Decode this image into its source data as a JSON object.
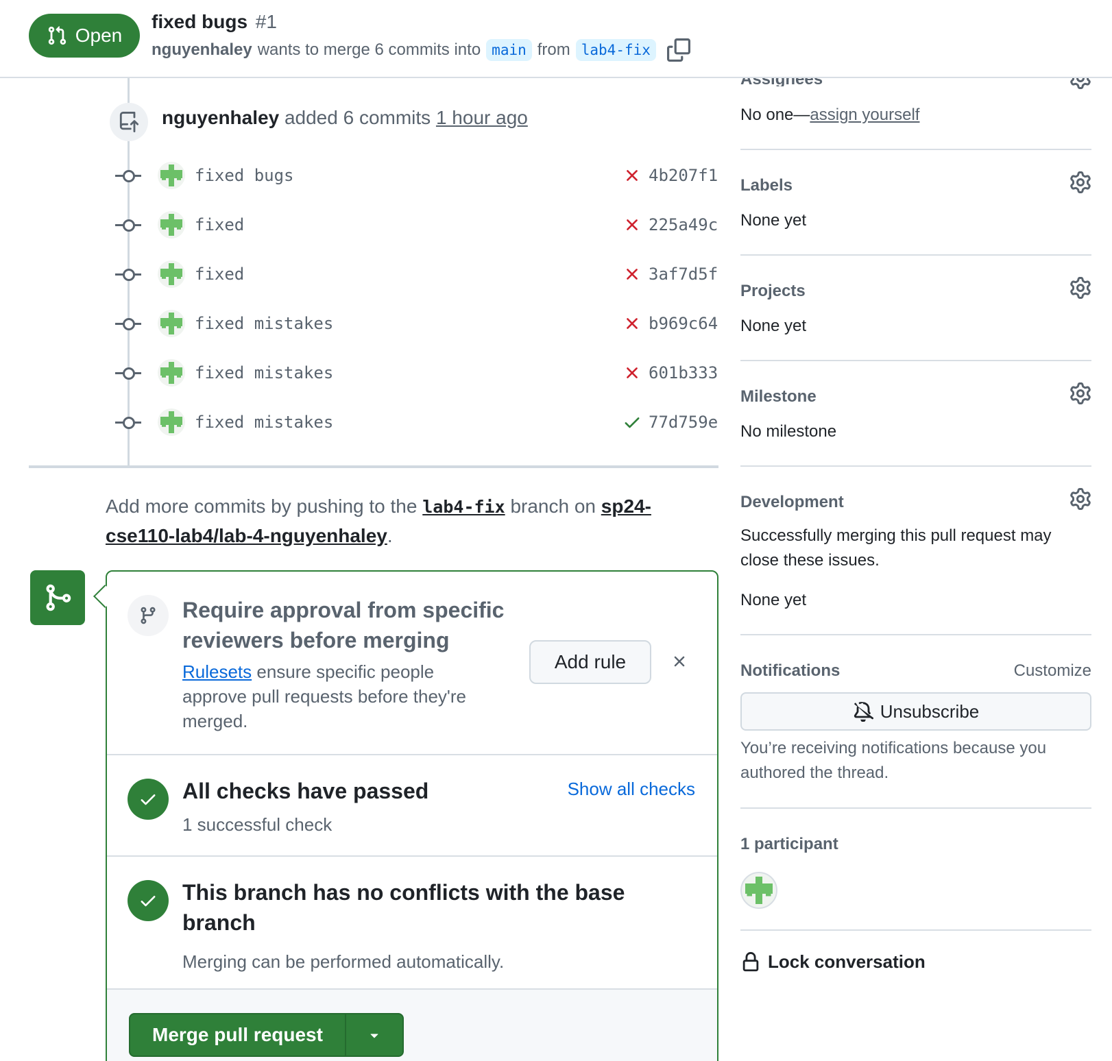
{
  "header": {
    "state": "Open",
    "title": "fixed bugs",
    "number": "#1",
    "author": "nguyenhaley",
    "merge_text": "wants to merge 6 commits into",
    "base_branch": "main",
    "from_text": "from",
    "head_branch": "lab4-fix"
  },
  "timeline": {
    "push_author": "nguyenhaley",
    "push_action": "added 6 commits",
    "push_time": "1 hour ago",
    "commits": [
      {
        "message": "fixed bugs",
        "sha": "4b207f1",
        "status": "failed"
      },
      {
        "message": "fixed",
        "sha": "225a49c",
        "status": "failed"
      },
      {
        "message": "fixed",
        "sha": "3af7d5f",
        "status": "failed"
      },
      {
        "message": "fixed mistakes",
        "sha": "b969c64",
        "status": "failed"
      },
      {
        "message": "fixed mistakes",
        "sha": "601b333",
        "status": "failed"
      },
      {
        "message": "fixed mistakes",
        "sha": "77d759e",
        "status": "success"
      }
    ]
  },
  "add_more": {
    "prefix": "Add more commits by pushing to the",
    "branch": "lab4-fix",
    "middle": "branch on",
    "repo": "sp24-cse110-lab4/lab-4-nguyenhaley",
    "suffix": "."
  },
  "merge_box": {
    "rule_title": "Require approval from specific reviewers before merging",
    "rule_link": "Rulesets",
    "rule_desc": "ensure specific people approve pull requests before they're merged.",
    "add_rule": "Add rule",
    "checks_title": "All checks have passed",
    "checks_sub": "1 successful check",
    "show_checks": "Show all checks",
    "conflicts_title": "This branch has no conflicts with the base branch",
    "conflicts_sub": "Merging can be performed automatically.",
    "merge_button": "Merge pull request"
  },
  "sidebar": {
    "assignees_head": "Assignees",
    "assignees_none": "No one—",
    "assign_yourself": "assign yourself",
    "labels_head": "Labels",
    "labels_value": "None yet",
    "projects_head": "Projects",
    "projects_value": "None yet",
    "milestone_head": "Milestone",
    "milestone_value": "No milestone",
    "development_head": "Development",
    "development_desc": "Successfully merging this pull request may close these issues.",
    "development_value": "None yet",
    "notifications_head": "Notifications",
    "customize": "Customize",
    "unsubscribe": "Unsubscribe",
    "notif_reason": "You’re receiving notifications because you authored the thread.",
    "participants_head": "1 participant",
    "lock": "Lock conversation"
  },
  "colors": {
    "success_green": "#2f8039",
    "link_blue": "#0969da",
    "fail_red": "#cf222e",
    "muted": "#59636e"
  }
}
